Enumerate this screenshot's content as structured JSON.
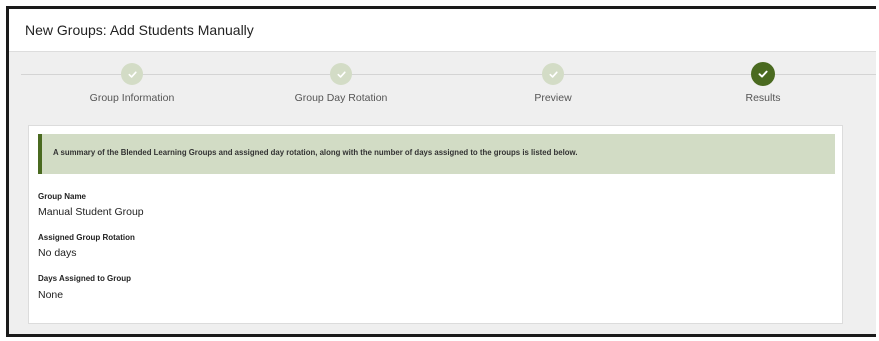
{
  "header": {
    "title": "New Groups: Add Students Manually"
  },
  "wizard": {
    "steps": [
      {
        "label": "Group Information",
        "state": "complete"
      },
      {
        "label": "Group Day Rotation",
        "state": "complete"
      },
      {
        "label": "Preview",
        "state": "complete"
      },
      {
        "label": "Results",
        "state": "current"
      }
    ],
    "icon": "checkmark-icon"
  },
  "alert": {
    "text": "A summary of the Blended Learning Groups and assigned day rotation, along with the number of days assigned to the groups is listed below."
  },
  "summary": {
    "group_name_label": "Group Name",
    "group_name_value": "Manual Student Group",
    "rotation_label": "Assigned Group Rotation",
    "rotation_value": "No days",
    "days_label": "Days Assigned to Group",
    "days_value": "None"
  },
  "colors": {
    "accent": "#4a6a20",
    "step_complete": "#d3dcc6",
    "alert_bg": "#d2dcc5",
    "panel_bg": "#efefef"
  }
}
